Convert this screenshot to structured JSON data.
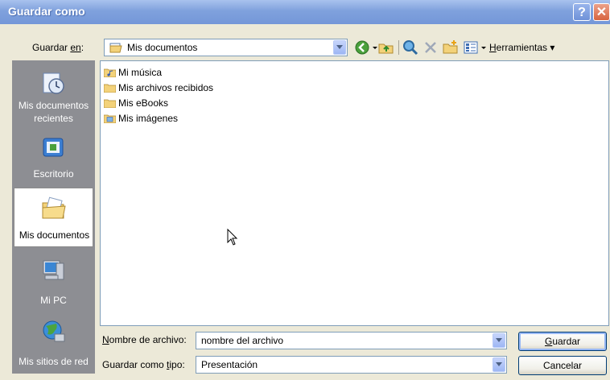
{
  "window": {
    "title": "Guardar como",
    "help_glyph": "?",
    "close_glyph": "✕"
  },
  "save_in": {
    "label_prefix": "Guardar ",
    "label_mnemonic": "en",
    "label_suffix": ":",
    "value": "Mis documentos"
  },
  "toolbar": {
    "icons": [
      "back-icon",
      "up-folder-icon",
      "search-web-icon",
      "delete-icon",
      "new-folder-icon",
      "views-icon"
    ],
    "tools_mnemonic": "H",
    "tools_rest": "erramientas"
  },
  "places": [
    {
      "icon": "recent-documents-icon",
      "line1": "Mis documentos",
      "line2": "recientes"
    },
    {
      "icon": "desktop-icon",
      "line1": "Escritorio",
      "line2": ""
    },
    {
      "icon": "my-documents-icon",
      "line1": "Mis documentos",
      "line2": ""
    },
    {
      "icon": "my-computer-icon",
      "line1": "Mi PC",
      "line2": ""
    },
    {
      "icon": "network-places-icon",
      "line1": "Mis sitios de red",
      "line2": ""
    }
  ],
  "files": [
    {
      "name": "Mi música",
      "icon": "music-folder-icon"
    },
    {
      "name": "Mis archivos recibidos",
      "icon": "folder-icon"
    },
    {
      "name": "Mis eBooks",
      "icon": "folder-icon"
    },
    {
      "name": "Mis imágenes",
      "icon": "pictures-folder-icon"
    }
  ],
  "filename": {
    "label_mnemonic": "N",
    "label_rest": "ombre de archivo:",
    "value": "nombre del archivo"
  },
  "filetype": {
    "label_prefix": "Guardar como ",
    "label_mnemonic": "t",
    "label_suffix": "ipo:",
    "value": "Presentación"
  },
  "buttons": {
    "save_mnemonic": "G",
    "save_rest": "uardar",
    "cancel": "Cancelar"
  },
  "colors": {
    "title_bar": "#7fa1dd",
    "places_bar": "#8d8e93",
    "dialog_bg": "#ece9d8"
  }
}
